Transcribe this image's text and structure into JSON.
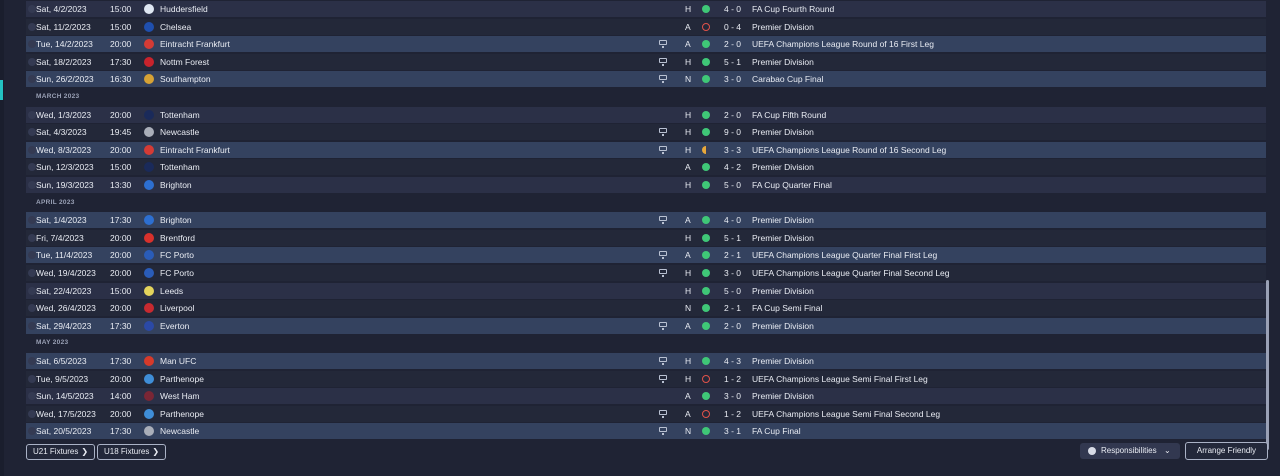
{
  "colors": {
    "accent": "#23c2c2",
    "win": "#3fc777",
    "loss": "#e0524a",
    "draw": "#e9a83a"
  },
  "rows": [
    {
      "type": "fixture",
      "date": "Sat, 4/2/2023",
      "time": "15:00",
      "opponent": "Huddersfield",
      "badge_color": "#dfe7f2",
      "tv": false,
      "venue": "H",
      "result": "W",
      "score": "4 - 0",
      "competition": "FA Cup Fourth Round"
    },
    {
      "type": "fixture",
      "date": "Sat, 11/2/2023",
      "time": "15:00",
      "opponent": "Chelsea",
      "badge_color": "#1f4fae",
      "tv": false,
      "venue": "A",
      "result": "L",
      "score": "0 - 4",
      "competition": "Premier Division"
    },
    {
      "type": "fixture",
      "date": "Tue, 14/2/2023",
      "time": "20:00",
      "opponent": "Eintracht Frankfurt",
      "badge_color": "#d43b35",
      "tv": true,
      "venue": "A",
      "result": "W",
      "score": "2 - 0",
      "competition": "UEFA Champions League Round of 16 First Leg"
    },
    {
      "type": "fixture",
      "date": "Sat, 18/2/2023",
      "time": "17:30",
      "opponent": "Nottm Forest",
      "badge_color": "#c8232c",
      "tv": true,
      "venue": "H",
      "result": "W",
      "score": "5 - 1",
      "competition": "Premier Division"
    },
    {
      "type": "fixture",
      "date": "Sun, 26/2/2023",
      "time": "16:30",
      "opponent": "Southampton",
      "badge_color": "#d6a235",
      "tv": true,
      "venue": "N",
      "result": "W",
      "score": "3 - 0",
      "competition": "Carabao Cup Final"
    },
    {
      "type": "month",
      "label": "MARCH 2023"
    },
    {
      "type": "fixture",
      "date": "Wed, 1/3/2023",
      "time": "20:00",
      "opponent": "Tottenham",
      "badge_color": "#1a2a5a",
      "tv": false,
      "venue": "H",
      "result": "W",
      "score": "2 - 0",
      "competition": "FA Cup Fifth Round"
    },
    {
      "type": "fixture",
      "date": "Sat, 4/3/2023",
      "time": "19:45",
      "opponent": "Newcastle",
      "badge_color": "#a9aeb9",
      "tv": true,
      "venue": "H",
      "result": "W",
      "score": "9 - 0",
      "competition": "Premier Division"
    },
    {
      "type": "fixture",
      "date": "Wed, 8/3/2023",
      "time": "20:00",
      "opponent": "Eintracht Frankfurt",
      "badge_color": "#d43b35",
      "tv": true,
      "venue": "H",
      "result": "D",
      "score": "3 - 3",
      "competition": "UEFA Champions League Round of 16 Second Leg"
    },
    {
      "type": "fixture",
      "date": "Sun, 12/3/2023",
      "time": "15:00",
      "opponent": "Tottenham",
      "badge_color": "#1a2a5a",
      "tv": false,
      "venue": "A",
      "result": "W",
      "score": "4 - 2",
      "competition": "Premier Division"
    },
    {
      "type": "fixture",
      "date": "Sun, 19/3/2023",
      "time": "13:30",
      "opponent": "Brighton",
      "badge_color": "#2d6fd1",
      "tv": false,
      "venue": "H",
      "result": "W",
      "score": "5 - 0",
      "competition": "FA Cup Quarter Final"
    },
    {
      "type": "month",
      "label": "APRIL 2023"
    },
    {
      "type": "fixture",
      "date": "Sat, 1/4/2023",
      "time": "17:30",
      "opponent": "Brighton",
      "badge_color": "#2d6fd1",
      "tv": true,
      "venue": "A",
      "result": "W",
      "score": "4 - 0",
      "competition": "Premier Division"
    },
    {
      "type": "fixture",
      "date": "Fri, 7/4/2023",
      "time": "20:00",
      "opponent": "Brentford",
      "badge_color": "#d8312c",
      "tv": false,
      "venue": "H",
      "result": "W",
      "score": "5 - 1",
      "competition": "Premier Division"
    },
    {
      "type": "fixture",
      "date": "Tue, 11/4/2023",
      "time": "20:00",
      "opponent": "FC Porto",
      "badge_color": "#2a5cb8",
      "tv": true,
      "venue": "A",
      "result": "W",
      "score": "2 - 1",
      "competition": "UEFA Champions League Quarter Final First Leg"
    },
    {
      "type": "fixture",
      "date": "Wed, 19/4/2023",
      "time": "20:00",
      "opponent": "FC Porto",
      "badge_color": "#2a5cb8",
      "tv": true,
      "venue": "H",
      "result": "W",
      "score": "3 - 0",
      "competition": "UEFA Champions League Quarter Final Second Leg"
    },
    {
      "type": "fixture",
      "date": "Sat, 22/4/2023",
      "time": "15:00",
      "opponent": "Leeds",
      "badge_color": "#e3d35c",
      "tv": false,
      "venue": "H",
      "result": "W",
      "score": "5 - 0",
      "competition": "Premier Division"
    },
    {
      "type": "fixture",
      "date": "Wed, 26/4/2023",
      "time": "20:00",
      "opponent": "Liverpool",
      "badge_color": "#c72a30",
      "tv": false,
      "venue": "N",
      "result": "W",
      "score": "2 - 1",
      "competition": "FA Cup Semi Final"
    },
    {
      "type": "fixture",
      "date": "Sat, 29/4/2023",
      "time": "17:30",
      "opponent": "Everton",
      "badge_color": "#2b49a6",
      "tv": true,
      "venue": "A",
      "result": "W",
      "score": "2 - 0",
      "competition": "Premier Division"
    },
    {
      "type": "month",
      "label": "MAY 2023"
    },
    {
      "type": "fixture",
      "date": "Sat, 6/5/2023",
      "time": "17:30",
      "opponent": "Man UFC",
      "badge_color": "#d63a2a",
      "tv": true,
      "venue": "H",
      "result": "W",
      "score": "4 - 3",
      "competition": "Premier Division"
    },
    {
      "type": "fixture",
      "date": "Tue, 9/5/2023",
      "time": "20:00",
      "opponent": "Parthenope",
      "badge_color": "#3f8ed8",
      "tv": true,
      "venue": "H",
      "result": "L",
      "score": "1 - 2",
      "competition": "UEFA Champions League Semi Final First Leg"
    },
    {
      "type": "fixture",
      "date": "Sun, 14/5/2023",
      "time": "14:00",
      "opponent": "West Ham",
      "badge_color": "#7a2635",
      "tv": false,
      "venue": "A",
      "result": "W",
      "score": "3 - 0",
      "competition": "Premier Division"
    },
    {
      "type": "fixture",
      "date": "Wed, 17/5/2023",
      "time": "20:00",
      "opponent": "Parthenope",
      "badge_color": "#3f8ed8",
      "tv": true,
      "venue": "A",
      "result": "L",
      "score": "1 - 2",
      "competition": "UEFA Champions League Semi Final Second Leg"
    },
    {
      "type": "fixture",
      "date": "Sat, 20/5/2023",
      "time": "17:30",
      "opponent": "Newcastle",
      "badge_color": "#a9aeb9",
      "tv": true,
      "venue": "N",
      "result": "W",
      "score": "3 - 1",
      "competition": "FA Cup Final"
    }
  ],
  "buttons": {
    "u21": "U21 Fixtures",
    "u18": "U18 Fixtures",
    "responsibilities": "Responsibilities",
    "arrange_friendly": "Arrange Friendly"
  },
  "icons": {
    "dropdown": "chevron-down-icon",
    "forward": "chevron-right-icon",
    "responsibilities": "staff-icon",
    "tv": "tv-icon"
  }
}
